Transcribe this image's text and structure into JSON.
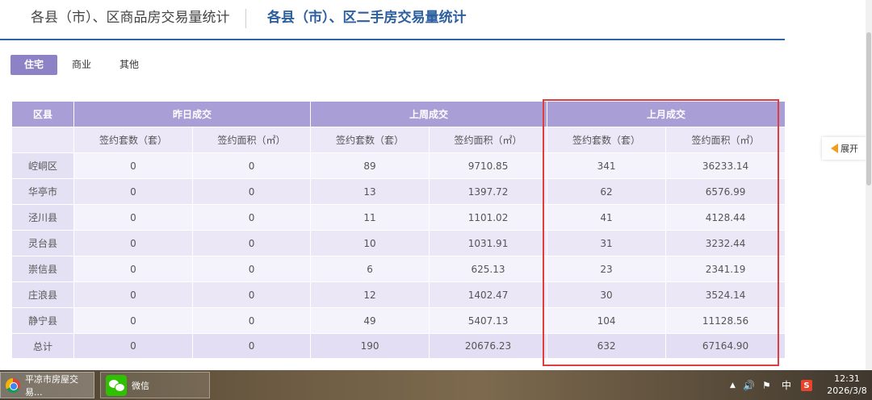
{
  "tabs": {
    "inactive": "各县（市）、区商品房交易量统计",
    "active": "各县（市）、区二手房交易量统计"
  },
  "subtabs": [
    "住宅",
    "商业",
    "其他"
  ],
  "table": {
    "col_district": "区县",
    "groups": [
      "昨日成交",
      "上周成交",
      "上月成交"
    ],
    "sub_count": "签约套数（套）",
    "sub_area": "签约面积（㎡）",
    "rows": [
      {
        "name": "崆峒区",
        "yd_count": "0",
        "yd_area": "0",
        "lw_count": "89",
        "lw_area": "9710.85",
        "lm_count": "341",
        "lm_area": "36233.14"
      },
      {
        "name": "华亭市",
        "yd_count": "0",
        "yd_area": "0",
        "lw_count": "13",
        "lw_area": "1397.72",
        "lm_count": "62",
        "lm_area": "6576.99"
      },
      {
        "name": "泾川县",
        "yd_count": "0",
        "yd_area": "0",
        "lw_count": "11",
        "lw_area": "1101.02",
        "lm_count": "41",
        "lm_area": "4128.44"
      },
      {
        "name": "灵台县",
        "yd_count": "0",
        "yd_area": "0",
        "lw_count": "10",
        "lw_area": "1031.91",
        "lm_count": "31",
        "lm_area": "3232.44"
      },
      {
        "name": "崇信县",
        "yd_count": "0",
        "yd_area": "0",
        "lw_count": "6",
        "lw_area": "625.13",
        "lm_count": "23",
        "lm_area": "2341.19"
      },
      {
        "name": "庄浪县",
        "yd_count": "0",
        "yd_area": "0",
        "lw_count": "12",
        "lw_area": "1402.47",
        "lm_count": "30",
        "lm_area": "3524.14"
      },
      {
        "name": "静宁县",
        "yd_count": "0",
        "yd_area": "0",
        "lw_count": "49",
        "lw_area": "5407.13",
        "lm_count": "104",
        "lm_area": "11128.56"
      }
    ],
    "total": {
      "name": "总计",
      "yd_count": "0",
      "yd_area": "0",
      "lw_count": "190",
      "lw_area": "20676.23",
      "lm_count": "632",
      "lm_area": "67164.90"
    }
  },
  "expand_label": "展开",
  "taskbar": {
    "task1": "平凉市房屋交易...",
    "task2": "微信",
    "lang": "中",
    "sogou": "S",
    "time": "12:31",
    "date": "2026/3/8"
  },
  "colors": {
    "header_purple": "#a99ed6",
    "active_tab_blue": "#2c5fa0",
    "highlight_red": "#e03d3d"
  }
}
